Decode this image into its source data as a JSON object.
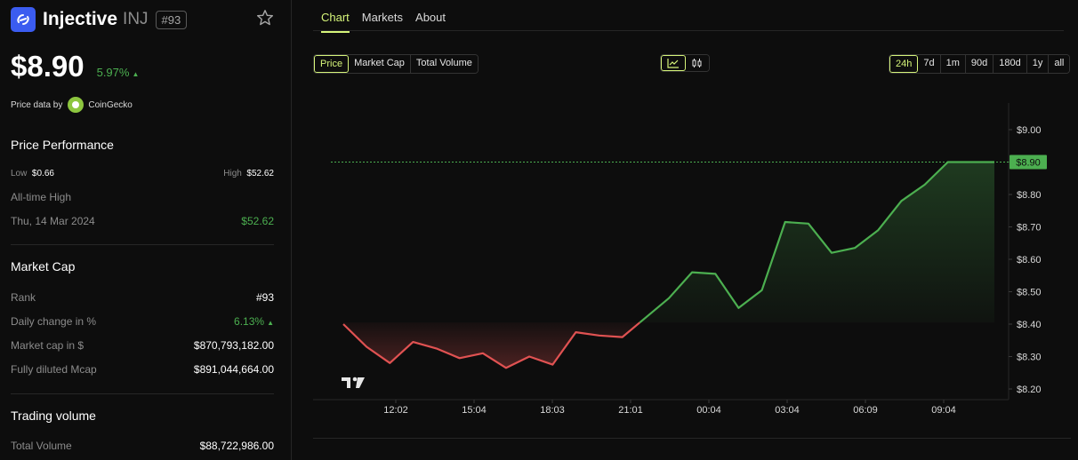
{
  "coin": {
    "name": "Injective",
    "symbol": "INJ",
    "rank_badge": "#93",
    "price": "$8.90",
    "change_24h": "5.97%",
    "change_direction": "up",
    "price_data_by": "Price data by",
    "provider": "CoinGecko"
  },
  "performance": {
    "title": "Price Performance",
    "low_label": "Low",
    "low_value": "$0.66",
    "high_label": "High",
    "high_value": "$52.62",
    "ath_label": "All-time High",
    "ath_date": "Thu, 14 Mar 2024",
    "ath_value": "$52.62"
  },
  "market_cap": {
    "title": "Market Cap",
    "rows": [
      {
        "label": "Rank",
        "value": "#93"
      },
      {
        "label": "Daily change in %",
        "value": "6.13%"
      },
      {
        "label": "Market cap in $",
        "value": "$870,793,182.00"
      },
      {
        "label": "Fully diluted Mcap",
        "value": "$891,044,664.00"
      }
    ]
  },
  "trading": {
    "title": "Trading volume",
    "rows": [
      {
        "label": "Total Volume",
        "value": "$88,722,986.00"
      }
    ]
  },
  "tabs": [
    {
      "label": "Chart",
      "active": true
    },
    {
      "label": "Markets",
      "active": false
    },
    {
      "label": "About",
      "active": false
    }
  ],
  "metric_buttons": [
    {
      "label": "Price",
      "active": true
    },
    {
      "label": "Market Cap",
      "active": false
    },
    {
      "label": "Total Volume",
      "active": false
    }
  ],
  "chart_style_buttons": [
    {
      "icon": "line-chart-icon",
      "active": true
    },
    {
      "icon": "candlestick-icon",
      "active": false
    }
  ],
  "range_buttons": [
    {
      "label": "24h",
      "active": true
    },
    {
      "label": "7d",
      "active": false
    },
    {
      "label": "1m",
      "active": false
    },
    {
      "label": "90d",
      "active": false
    },
    {
      "label": "180d",
      "active": false
    },
    {
      "label": "1y",
      "active": false
    },
    {
      "label": "all",
      "active": false
    }
  ],
  "colors": {
    "accent": "#d6f57a",
    "up": "#4caf50",
    "down": "#e05252",
    "brand": "#3b5cf0"
  },
  "chart_data": {
    "type": "line",
    "x": [
      "10:40",
      "11:20",
      "12:02",
      "12:40",
      "13:20",
      "14:20",
      "15:04",
      "15:50",
      "16:40",
      "17:30",
      "18:03",
      "18:50",
      "19:40",
      "20:30",
      "21:01",
      "21:50",
      "23:00",
      "00:04",
      "01:10",
      "02:10",
      "03:04",
      "03:50",
      "04:50",
      "05:40",
      "06:09",
      "07:05",
      "08:05",
      "09:04",
      "09:40"
    ],
    "values": [
      8.4,
      8.33,
      8.28,
      8.345,
      8.325,
      8.295,
      8.31,
      8.265,
      8.3,
      8.275,
      8.375,
      8.365,
      8.36,
      8.42,
      8.48,
      8.56,
      8.555,
      8.45,
      8.505,
      8.715,
      8.71,
      8.62,
      8.635,
      8.69,
      8.78,
      8.83,
      8.9,
      8.9,
      8.9
    ],
    "baseline": 8.405,
    "current_price_label": "$8.90",
    "y_ticks": [
      "$9.00",
      "$8.90",
      "$8.80",
      "$8.70",
      "$8.60",
      "$8.50",
      "$8.40",
      "$8.30",
      "$8.20"
    ],
    "y_tick_values": [
      9.0,
      8.9,
      8.8,
      8.7,
      8.6,
      8.5,
      8.4,
      8.3,
      8.2
    ],
    "x_ticks": [
      "12:02",
      "15:04",
      "18:03",
      "21:01",
      "00:04",
      "03:04",
      "06:09",
      "09:04"
    ],
    "ylim": [
      8.16,
      9.08
    ],
    "title": "",
    "xlabel": "",
    "ylabel": "",
    "grid": false,
    "watermark": "TV"
  }
}
